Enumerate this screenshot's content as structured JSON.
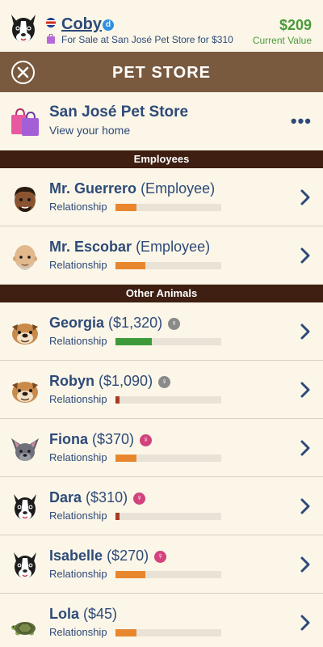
{
  "header": {
    "name": "Coby",
    "verified_mark": "d",
    "subtitle": "For Sale at San José Pet Store for $310",
    "value": "$209",
    "value_label": "Current Value"
  },
  "titlebar": {
    "title": "PET STORE"
  },
  "store": {
    "name": "San José Pet Store",
    "subtitle": "View your home",
    "more": "•••"
  },
  "sections": {
    "employees": "Employees",
    "other_animals": "Other Animals"
  },
  "employees": [
    {
      "name": "Mr. Guerrero",
      "role": "(Employee)",
      "relationship_label": "Relationship",
      "relationship": 0.2,
      "bar_color": "#e8862e",
      "icon": "man-dark-avatar-icon"
    },
    {
      "name": "Mr. Escobar",
      "role": "(Employee)",
      "relationship_label": "Relationship",
      "relationship": 0.28,
      "bar_color": "#e8862e",
      "icon": "man-bald-avatar-icon"
    }
  ],
  "animals": [
    {
      "name": "Georgia",
      "price": "($1,320)",
      "gender": "neutral",
      "gender_glyph": "♀",
      "relationship_label": "Relationship",
      "relationship": 0.34,
      "bar_color": "#3c9a3a",
      "icon": "bulldog-icon"
    },
    {
      "name": "Robyn",
      "price": "($1,090)",
      "gender": "neutral",
      "gender_glyph": "♀",
      "relationship_label": "Relationship",
      "relationship": 0.04,
      "bar_color": "#a83a24",
      "icon": "bulldog-icon"
    },
    {
      "name": "Fiona",
      "price": "($370)",
      "gender": "female",
      "gender_glyph": "♀",
      "relationship_label": "Relationship",
      "relationship": 0.2,
      "bar_color": "#e8862e",
      "icon": "bat-eared-dog-icon"
    },
    {
      "name": "Dara",
      "price": "($310)",
      "gender": "female",
      "gender_glyph": "♀",
      "relationship_label": "Relationship",
      "relationship": 0.04,
      "bar_color": "#a83a24",
      "icon": "boston-terrier-icon"
    },
    {
      "name": "Isabelle",
      "price": "($270)",
      "gender": "female",
      "gender_glyph": "♀",
      "relationship_label": "Relationship",
      "relationship": 0.28,
      "bar_color": "#e8862e",
      "icon": "boston-terrier-icon"
    },
    {
      "name": "Lola",
      "price": "($45)",
      "gender": "",
      "gender_glyph": "",
      "relationship_label": "Relationship",
      "relationship": 0.2,
      "bar_color": "#e8862e",
      "icon": "turtle-icon"
    }
  ]
}
